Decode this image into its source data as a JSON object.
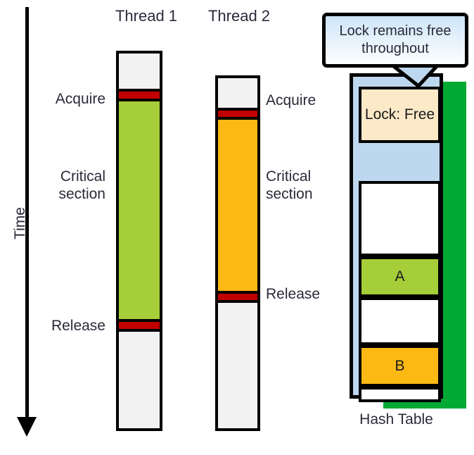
{
  "diagram": {
    "title_axis": "Time",
    "threads": [
      {
        "id": "thread1",
        "title": "Thread 1",
        "color": "#A6CE39",
        "segments": [
          {
            "kind": "idle",
            "label": ""
          },
          {
            "kind": "acquire",
            "label": "Acquire"
          },
          {
            "kind": "critical",
            "label": "Critical\nsection"
          },
          {
            "kind": "release",
            "label": "Release"
          },
          {
            "kind": "idle",
            "label": ""
          }
        ]
      },
      {
        "id": "thread2",
        "title": "Thread 2",
        "color": "#FCB813",
        "segments": [
          {
            "kind": "idle",
            "label": ""
          },
          {
            "kind": "acquire",
            "label": "Acquire"
          },
          {
            "kind": "critical",
            "label": "Critical\nsection"
          },
          {
            "kind": "release",
            "label": "Release"
          },
          {
            "kind": "idle",
            "label": ""
          }
        ]
      }
    ],
    "labels": {
      "t1_acquire": "Acquire",
      "t1_critical": "Critical\nsection",
      "t1_release": "Release",
      "t2_acquire": "Acquire",
      "t2_critical": "Critical\nsection",
      "t2_release": "Release"
    },
    "callout": {
      "text": "Lock remains free throughout"
    },
    "hash_table": {
      "caption": "Hash\nTable",
      "cells": [
        {
          "name": "lock",
          "text": "Lock: Free",
          "fill": "#FCE9C8"
        },
        {
          "name": "empty-1",
          "text": "",
          "fill": "#FFFFFF"
        },
        {
          "name": "entry-a",
          "text": "A",
          "fill": "#A6CE39"
        },
        {
          "name": "empty-2",
          "text": "",
          "fill": "#FFFFFF"
        },
        {
          "name": "entry-b",
          "text": "B",
          "fill": "#FCB813"
        },
        {
          "name": "empty-3",
          "text": "",
          "fill": "#FFFFFF"
        }
      ],
      "shadow_color": "#00A933",
      "background_color": "#BDD7EE"
    },
    "colors": {
      "lock_band": "#C00000",
      "idle": "#F2F2F2",
      "thread1_critical": "#A6CE39",
      "thread2_critical": "#FCB813",
      "outline": "#000000",
      "text": "#2a2a3a"
    }
  }
}
